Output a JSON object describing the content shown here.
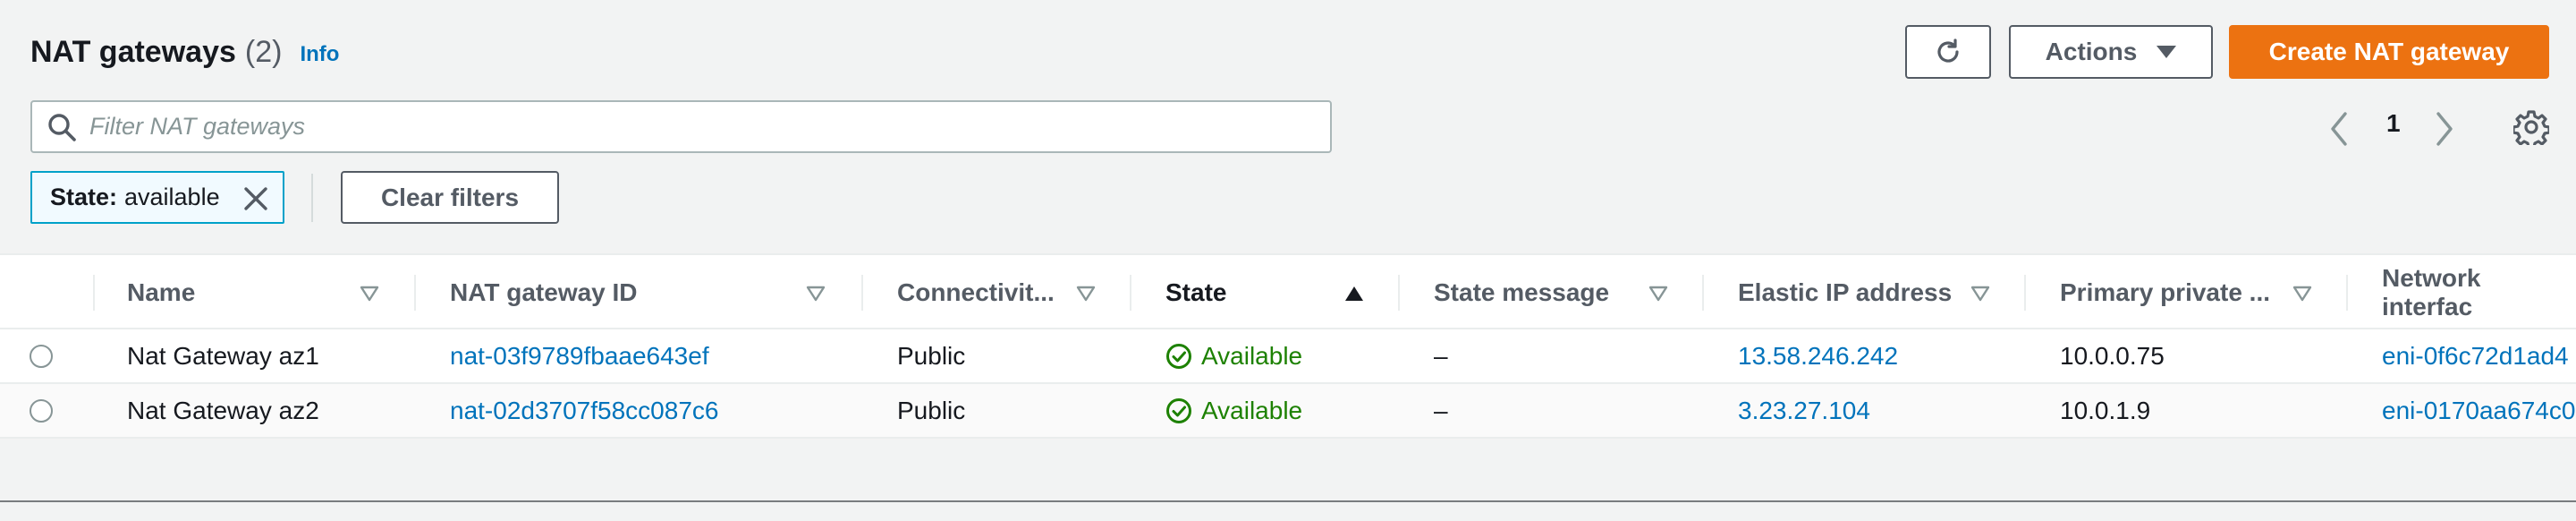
{
  "header": {
    "title": "NAT gateways",
    "count": "(2)",
    "info": "Info",
    "actions_label": "Actions",
    "create_label": "Create NAT gateway"
  },
  "filter": {
    "placeholder": "Filter NAT gateways",
    "value": "",
    "chip_key": "State:",
    "chip_value": "available",
    "clear_label": "Clear filters"
  },
  "pagination": {
    "current_page": "1"
  },
  "table": {
    "columns": [
      "Name",
      "NAT gateway ID",
      "Connectivit...",
      "State",
      "State message",
      "Elastic IP address",
      "Primary private ...",
      "Network interfac"
    ],
    "sorted_column": "State",
    "rows": [
      {
        "name": "Nat Gateway az1",
        "id": "nat-03f9789fbaae643ef",
        "connectivity": "Public",
        "state": "Available",
        "state_message": "–",
        "eip": "13.58.246.242",
        "private_ip": "10.0.0.75",
        "eni": "eni-0f6c72d1ad4"
      },
      {
        "name": "Nat Gateway az2",
        "id": "nat-02d3707f58cc087c6",
        "connectivity": "Public",
        "state": "Available",
        "state_message": "–",
        "eip": "3.23.27.104",
        "private_ip": "10.0.1.9",
        "eni": "eni-0170aa674c0"
      }
    ]
  },
  "colors": {
    "primary": "#ec7211",
    "link": "#0073bb",
    "success": "#1d8102",
    "chip_border": "#00a1c9"
  },
  "icons": [
    "refresh-icon",
    "caret-down-icon",
    "search-icon",
    "chevron-left-icon",
    "chevron-right-icon",
    "gear-icon",
    "close-icon",
    "filter-sort-icon",
    "sort-ascending-icon",
    "status-success-icon"
  ]
}
